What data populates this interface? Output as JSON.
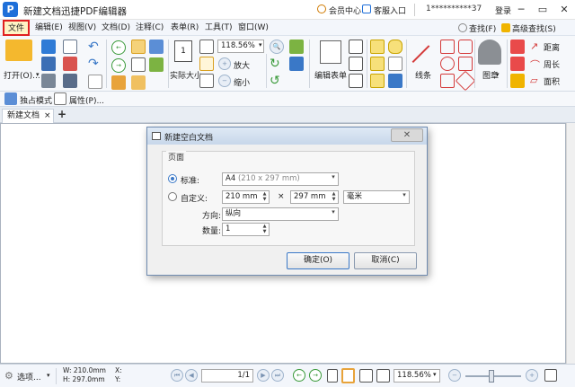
{
  "window": {
    "logo_letter": "P",
    "title": "新建文档迅捷PDF编辑器",
    "member_center": "会员中心",
    "client_entry": "客服入口",
    "account_id": "1**********37",
    "login": "登录",
    "minimize": "─",
    "restore": "▭",
    "close": "✕"
  },
  "menu": {
    "items": [
      "文件",
      "编辑(E)",
      "视图(V)",
      "文档(D)",
      "注释(C)",
      "表单(R)",
      "工具(T)",
      "窗口(W)"
    ],
    "find": "查找(F)",
    "advanced_find": "高级查找(S)"
  },
  "ribbon": {
    "open_label": "打开(O)...",
    "page_number": "1",
    "actual_size": "实际大小",
    "zoom_value": "118.56%",
    "zoom_in": "放大",
    "zoom_out": "缩小",
    "edit_form": "编辑表单",
    "lines": "线条",
    "shapes": "图章",
    "distance": "距离",
    "perimeter": "周长",
    "area": "面积",
    "exclusive_mode": "独占模式",
    "properties": "属性(P)..."
  },
  "tabs": {
    "doc_tab": "新建文档",
    "doc_tab_close": "×",
    "add_tab": "+"
  },
  "dialog": {
    "title": "新建空白文档",
    "close": "✕",
    "group_label": "页面",
    "standard_label": "标准:",
    "standard_value": "A4",
    "standard_hint": "(210 x 297 mm)",
    "custom_label": "自定义:",
    "width_value": "210 mm",
    "times": "×",
    "height_value": "297 mm",
    "unit_value": "毫米",
    "orientation_label": "方向:",
    "orientation_value": "纵向",
    "count_label": "数量:",
    "count_value": "1",
    "ok_label": "确定(O)",
    "cancel_label": "取消(C)"
  },
  "status": {
    "options": "选项...",
    "width": "W: 210.0mm",
    "height": "H: 297.0mm",
    "x": "X:",
    "y": "Y:",
    "page_value": "1/1",
    "zoom_value": "118.56%"
  },
  "colors": {
    "accent": "#1e6fd9",
    "highlight_border": "#e02020",
    "highlight_fill": "#fff3c4"
  },
  "icons": [
    "pdf-logo-icon",
    "open-folder-icon",
    "save-icon",
    "print-icon",
    "email-icon",
    "undo-icon",
    "redo-icon",
    "back-icon",
    "forward-icon",
    "hand-tool-icon",
    "select-icon",
    "snapshot-icon",
    "zoom-in-icon",
    "zoom-out-icon",
    "rotate-icon",
    "edit-form-icon",
    "text-field-icon",
    "checkbox-icon",
    "radio-icon",
    "text-icon",
    "note-icon",
    "audio-icon",
    "pencil-icon",
    "line-icon",
    "arrow-icon",
    "polygon-icon",
    "stamp-icon",
    "distance-icon",
    "perimeter-icon",
    "area-icon"
  ]
}
